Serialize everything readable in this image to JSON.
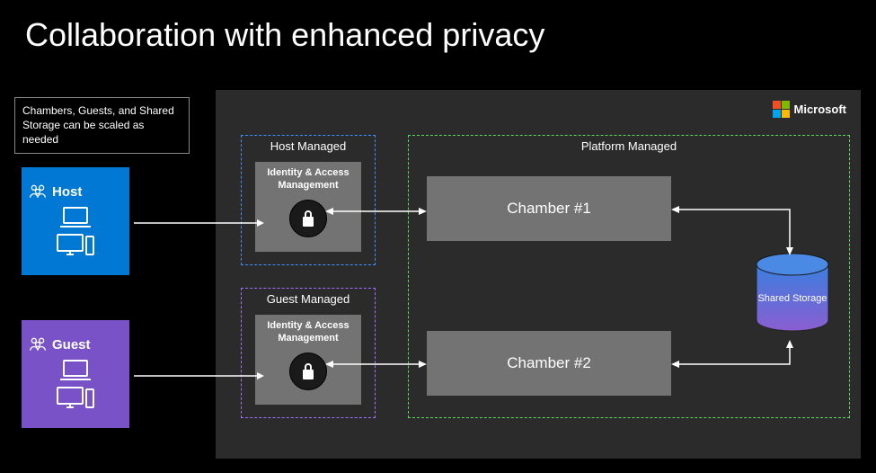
{
  "title": "Collaboration with enhanced privacy",
  "note": "Chambers, Guests, and Shared Storage can be scaled as needed",
  "brand": "Microsoft",
  "host": {
    "label": "Host",
    "managed_title": "Host Managed",
    "iam_label": "Identity & Access Management"
  },
  "guest": {
    "label": "Guest",
    "managed_title": "Guest Managed",
    "iam_label": "Identity & Access Management"
  },
  "platform": {
    "title": "Platform Managed",
    "chamber1": "Chamber #1",
    "chamber2": "Chamber #2"
  },
  "storage": {
    "label": "Shared Storage"
  }
}
